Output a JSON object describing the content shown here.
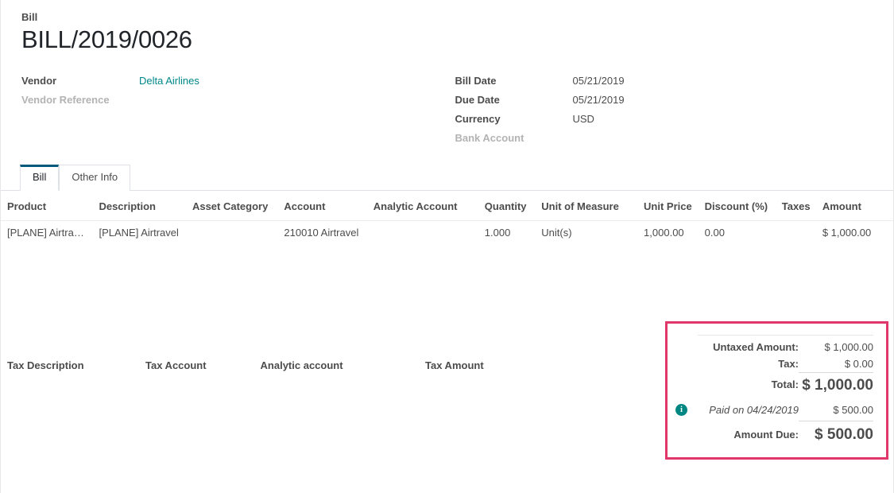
{
  "header": {
    "subtitle": "Bill",
    "title": "BILL/2019/0026"
  },
  "fields": {
    "left": [
      {
        "label": "Vendor",
        "value": "Delta Airlines",
        "style": "link"
      },
      {
        "label": "Vendor Reference",
        "value": "",
        "style": "muted"
      }
    ],
    "right": [
      {
        "label": "Bill Date",
        "value": "05/21/2019",
        "style": "normal"
      },
      {
        "label": "Due Date",
        "value": "05/21/2019",
        "style": "normal"
      },
      {
        "label": "Currency",
        "value": "USD",
        "style": "normal"
      },
      {
        "label": "Bank Account",
        "value": "",
        "style": "muted"
      }
    ]
  },
  "tabs": [
    {
      "label": "Bill",
      "active": true
    },
    {
      "label": "Other Info",
      "active": false
    }
  ],
  "lines_table": {
    "columns": [
      "Product",
      "Description",
      "Asset Category",
      "Account",
      "Analytic Account",
      "Quantity",
      "Unit of Measure",
      "Unit Price",
      "Discount (%)",
      "Taxes",
      "Amount"
    ],
    "rows": [
      {
        "product": "[PLANE] Airtravel",
        "description": "[PLANE] Airtravel",
        "asset_category": "",
        "account": "210010 Airtravel",
        "analytic_account": "",
        "quantity": "1.000",
        "unit_of_measure": "Unit(s)",
        "unit_price": "1,000.00",
        "discount": "0.00",
        "taxes": "",
        "amount": "$ 1,000.00"
      }
    ]
  },
  "tax_table": {
    "columns": [
      "Tax Description",
      "Tax Account",
      "Analytic account",
      "Tax Amount"
    ]
  },
  "totals": {
    "untaxed_label": "Untaxed Amount:",
    "untaxed_value": "$ 1,000.00",
    "tax_label": "Tax:",
    "tax_value": "$ 0.00",
    "total_label": "Total:",
    "total_value": "$ 1,000.00",
    "paid_label": "Paid on 04/24/2019",
    "paid_value": "$ 500.00",
    "paid_info_icon": "info-icon",
    "due_label": "Amount Due:",
    "due_value": "$ 500.00"
  },
  "colors": {
    "highlight_border": "#e0386b",
    "link": "#00878a",
    "info_icon": "#008784",
    "active_tab_border": "#00587a"
  }
}
